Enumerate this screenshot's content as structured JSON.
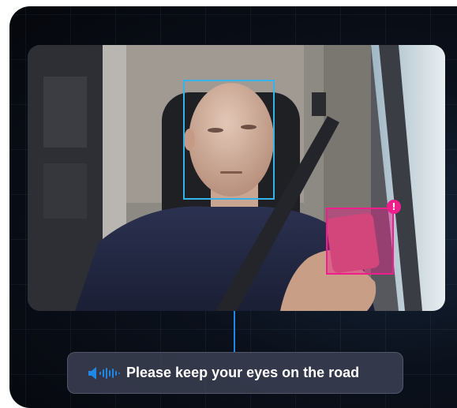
{
  "detections": {
    "face": {
      "label": "",
      "color": "#36b3ea"
    },
    "phone": {
      "label": "",
      "color": "#ee1e8c"
    },
    "alert_badge": {
      "symbol": "!",
      "icon": "exclamation-icon",
      "color": "#ee1e8c"
    }
  },
  "alert": {
    "icon": "speaker-sound-icon",
    "message": "Please keep your eyes on the road",
    "accent_color": "#1f87e6"
  }
}
